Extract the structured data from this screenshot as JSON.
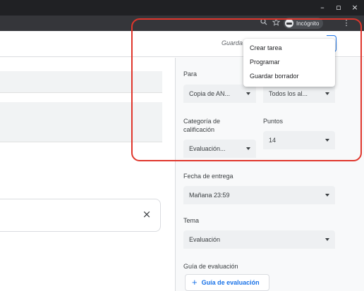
{
  "browser": {
    "minimize_glyph": "–",
    "maximize_glyph": "▫",
    "close_glyph": "×",
    "zoom_icon": "zoom-icon",
    "star_icon": "star-icon",
    "incognito_label": "Incógnito",
    "menu_glyph": "⋮"
  },
  "header": {
    "saved_label": "Guarda",
    "accent": "#1a73e8"
  },
  "dropdown": {
    "items": [
      "Crear tarea",
      "Programar",
      "Guardar borrador"
    ]
  },
  "main": {
    "close_glyph": "×"
  },
  "settings": {
    "para_label": "Para",
    "class_value": "Copia de AN...",
    "students_value": "Todos los al...",
    "category_label": "Categoría de calificación",
    "category_value": "Evaluación...",
    "points_label": "Puntos",
    "points_value": "14",
    "due_label": "Fecha de entrega",
    "due_value": "Mañana 23:59",
    "topic_label": "Tema",
    "topic_value": "Evaluación",
    "rubric_label": "Guía de evaluación",
    "rubric_button_plus": "+",
    "rubric_button_label": "Guía de evaluación"
  },
  "colors": {
    "highlight": "#e0362c",
    "chrome_dark": "#202124"
  }
}
